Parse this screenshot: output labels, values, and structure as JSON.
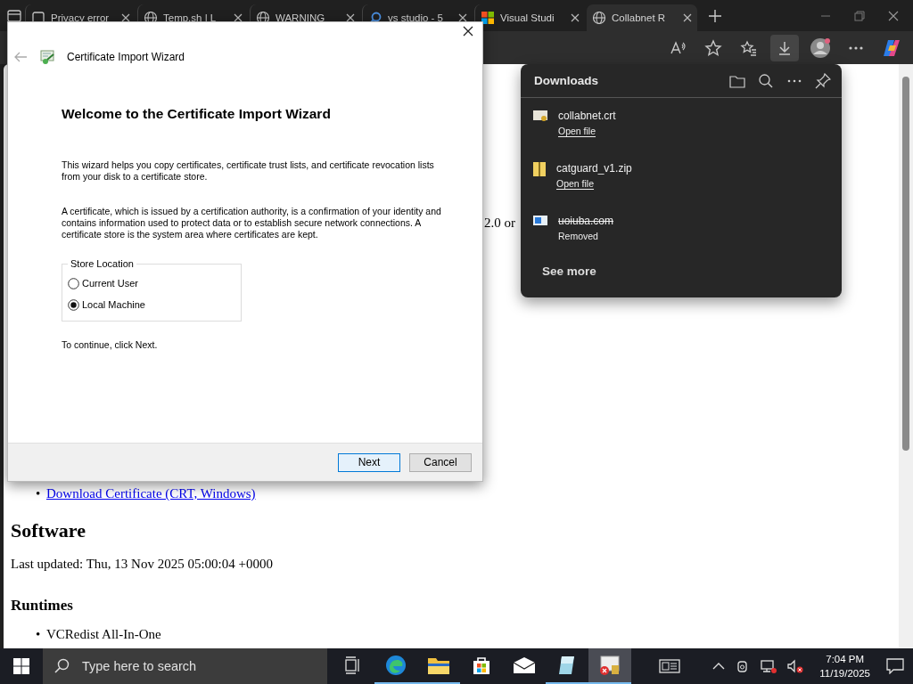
{
  "browser": {
    "tabs": [
      {
        "label": "Privacy error",
        "selected": false,
        "kind": "page"
      },
      {
        "label": "Temp.sh | L",
        "selected": false,
        "kind": "globe"
      },
      {
        "label": "WARNING",
        "selected": false,
        "kind": "globe"
      },
      {
        "label": "vs studio - 5",
        "selected": false,
        "kind": "search"
      },
      {
        "label": "Visual Studi",
        "selected": false,
        "kind": "tiles"
      },
      {
        "label": "Collabnet R",
        "selected": true,
        "kind": "globe"
      }
    ],
    "toolbar": [
      {
        "kind": "read-aloud",
        "selected": false
      },
      {
        "kind": "favorite",
        "selected": false
      },
      {
        "kind": "favorites",
        "selected": false
      },
      {
        "kind": "downloads",
        "selected": true
      },
      {
        "kind": "profile",
        "selected": false
      },
      {
        "kind": "more",
        "selected": false
      },
      {
        "kind": "copilot",
        "selected": false
      }
    ]
  },
  "page": {
    "fragment": "2.0 or",
    "links": [
      {
        "bullet": "•",
        "text": "Download Certificate (CRT, Windows)"
      }
    ],
    "heading": "Software",
    "updated": "Last updated: Thu, 13 Nov 2025 05:00:04 +0000",
    "subheading": "Runtimes",
    "items": [
      {
        "bullet": "•",
        "text": "VCRedist All-In-One"
      }
    ]
  },
  "downloads": {
    "title": "Downloads",
    "items": [
      {
        "file": "collabnet.crt",
        "status": "Open file",
        "removed": false,
        "kind": "certificate"
      },
      {
        "file": "catguard_v1.zip",
        "status": "Open file",
        "removed": false,
        "kind": "zip"
      },
      {
        "file": "uoiuba.com",
        "status": "Removed",
        "removed": true,
        "kind": "program"
      }
    ],
    "see_more": "See more"
  },
  "wizard": {
    "title": "Certificate Import Wizard",
    "heading": "Welcome to the Certificate Import Wizard",
    "paragraphs": [
      "This wizard helps you copy certificates, certificate trust lists, and certificate revocation lists from your disk to a certificate store.",
      "A certificate, which is issued by a certification authority, is a confirmation of your identity and contains information used to protect data or to establish secure network connections. A certificate store is the system area where certificates are kept."
    ],
    "store_location": {
      "label": "Store Location",
      "options": [
        {
          "label": "Current User",
          "selected": false
        },
        {
          "label": "Local Machine",
          "selected": true
        }
      ]
    },
    "hint": "To continue, click Next.",
    "buttons": [
      {
        "label": "Next",
        "focused": true
      },
      {
        "label": "Cancel",
        "focused": false
      }
    ]
  },
  "taskbar": {
    "search": {
      "placeholder": "Type here to search"
    },
    "apps": [
      {
        "kind": "task-view",
        "running": false,
        "active": false
      },
      {
        "kind": "browser",
        "running": true,
        "active": false
      },
      {
        "kind": "folder",
        "running": true,
        "active": false
      },
      {
        "kind": "store",
        "running": false,
        "active": false
      },
      {
        "kind": "mail",
        "running": false,
        "active": false
      },
      {
        "kind": "notes",
        "running": true,
        "active": false
      },
      {
        "kind": "certificate",
        "running": true,
        "active": true
      }
    ],
    "time": "7:04 PM",
    "date": "11/19/2025"
  }
}
